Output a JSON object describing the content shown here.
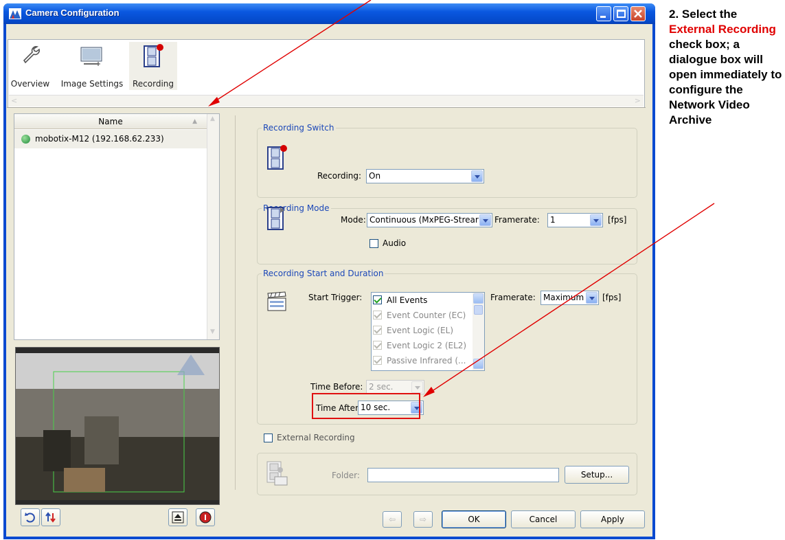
{
  "window": {
    "title": "Camera Configuration"
  },
  "toolbar": {
    "items": [
      {
        "label": "Overview",
        "icon": "wrench-icon"
      },
      {
        "label": "Image Settings",
        "icon": "image-settings-icon"
      },
      {
        "label": "Recording",
        "icon": "film-record-icon"
      }
    ]
  },
  "camera_list": {
    "column_header": "Name",
    "items": [
      {
        "label": "mobotix-M12 (192.168.62.233)",
        "status_color": "#1f8a3a"
      }
    ]
  },
  "recording_switch": {
    "group_label": "Recording Switch",
    "label": "Recording:",
    "value": "On"
  },
  "recording_mode": {
    "group_label": "Recording Mode",
    "mode_label": "Mode:",
    "mode_value": "Continuous (MxPEG-Strear",
    "framerate_label": "Framerate:",
    "framerate_value": "1",
    "unit": "[fps]",
    "audio_label": "Audio"
  },
  "recording_start": {
    "group_label": "Recording Start and Duration",
    "trigger_label": "Start Trigger:",
    "triggers": [
      {
        "label": "All Events",
        "checked": true,
        "enabled": true
      },
      {
        "label": "Event Counter (EC)",
        "checked": true,
        "enabled": false
      },
      {
        "label": "Event Logic (EL)",
        "checked": true,
        "enabled": false
      },
      {
        "label": "Event Logic 2 (EL2)",
        "checked": true,
        "enabled": false
      },
      {
        "label": "Passive Infrared (...",
        "checked": true,
        "enabled": false
      }
    ],
    "framerate_label": "Framerate:",
    "framerate_value": "Maximum",
    "unit": "[fps]",
    "time_before_label": "Time Before:",
    "time_before_value": "2 sec.",
    "time_after_label": "Time After:",
    "time_after_value": "10 sec."
  },
  "external_recording": {
    "label": "External Recording",
    "folder_label": "Folder:",
    "folder_value": "",
    "setup_label": "Setup..."
  },
  "buttons": {
    "ok": "OK",
    "cancel": "Cancel",
    "apply": "Apply"
  },
  "annotation": {
    "prefix": "2. Select the",
    "highlight": "External Recording",
    "suffix": "check box; a dialogue box will open immediately to configure the Network Video Archive"
  },
  "colors": {
    "title_bar": "#0a58e0",
    "group_label": "#1c48b8",
    "annotation_red": "#e00000",
    "highlight_box": "#e01010"
  }
}
